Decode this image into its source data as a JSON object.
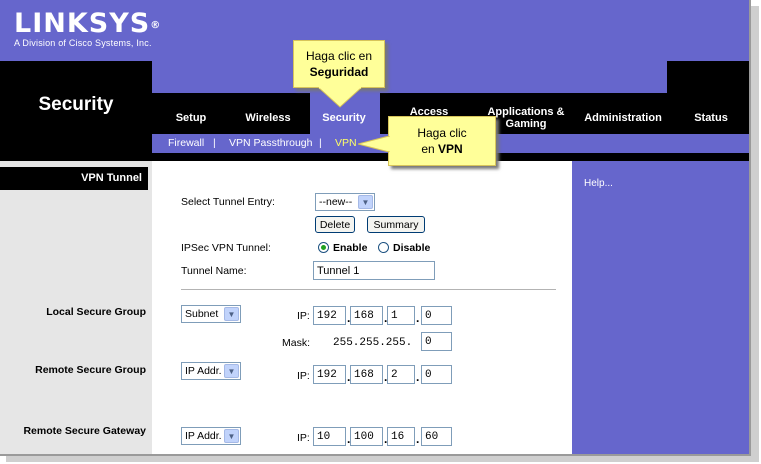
{
  "brand": {
    "name": "LINKSYS",
    "reg": "®",
    "subtitle": "A Division of Cisco Systems, Inc."
  },
  "section_title": "Security",
  "tabs": [
    {
      "label": "Setup"
    },
    {
      "label": "Wireless"
    },
    {
      "label": "Security",
      "active": true
    },
    {
      "label": "Access Restrictions"
    },
    {
      "label": "Applications & Gaming"
    },
    {
      "label": "Administration"
    },
    {
      "label": "Status"
    }
  ],
  "subnav": [
    {
      "label": "Firewall"
    },
    {
      "label": "|"
    },
    {
      "label": "VPN Passthrough"
    },
    {
      "label": "|"
    },
    {
      "label": "VPN",
      "selected": true
    }
  ],
  "callouts": {
    "security": {
      "line1": "Haga clic en",
      "line2": "Seguridad"
    },
    "vpn": {
      "line1": "Haga clic",
      "line2_prefix": "en ",
      "line2_bold": "VPN"
    }
  },
  "left": {
    "heading": "VPN Tunnel",
    "local_group": "Local Secure Group",
    "remote_group": "Remote Secure Group",
    "remote_gateway": "Remote Secure Gateway"
  },
  "help": "Help...",
  "form": {
    "tunnel_entry_label": "Select Tunnel Entry:",
    "tunnel_entry_value": "--new--",
    "delete_label": "Delete",
    "summary_label": "Summary",
    "ipsec_label": "IPSec VPN Tunnel:",
    "enable_label": "Enable",
    "disable_label": "Disable",
    "ipsec_state": "Enable",
    "tunnel_name_label": "Tunnel Name:",
    "tunnel_name_value": "Tunnel 1",
    "local": {
      "type": "Subnet",
      "ip_label": "IP:",
      "ip": [
        "192",
        "168",
        "1",
        "0"
      ],
      "mask_label": "Mask:",
      "mask_prefix": "255.255.255.",
      "mask_last": "0"
    },
    "remote": {
      "type": "IP Addr.",
      "ip_label": "IP:",
      "ip": [
        "192",
        "168",
        "2",
        "0"
      ]
    },
    "gateway": {
      "type": "IP Addr.",
      "ip_label": "IP:",
      "ip": [
        "10",
        "100",
        "16",
        "60"
      ]
    }
  },
  "dot": "."
}
